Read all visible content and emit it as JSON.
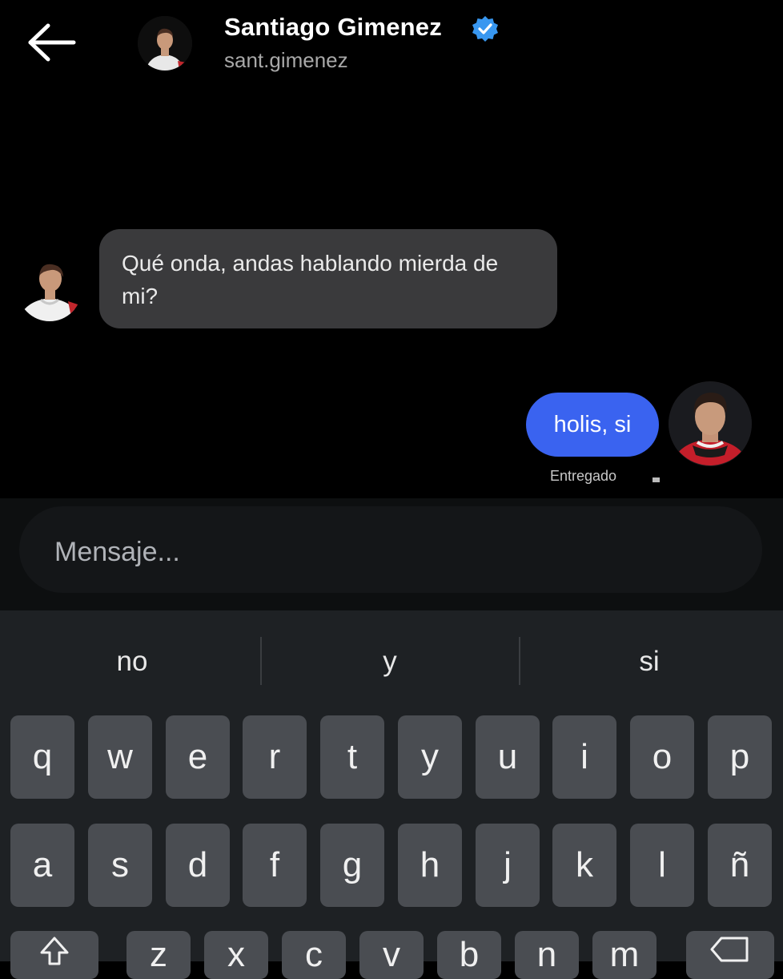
{
  "header": {
    "name": "Santiago Gimenez",
    "handle": "sant.gimenez",
    "verified": true,
    "back_icon": "arrow-left-icon",
    "verified_color": "#3897f0"
  },
  "messages": [
    {
      "direction": "incoming",
      "text": "Qué onda, andas hablando mierda de mi?"
    },
    {
      "direction": "outgoing",
      "text": "holis, si",
      "status": "Entregado"
    }
  ],
  "composer": {
    "placeholder": "Mensaje..."
  },
  "keyboard": {
    "suggestions": [
      "no",
      "y",
      "si"
    ],
    "row1": [
      "q",
      "w",
      "e",
      "r",
      "t",
      "y",
      "u",
      "i",
      "o",
      "p"
    ],
    "row2": [
      "a",
      "s",
      "d",
      "f",
      "g",
      "h",
      "j",
      "k",
      "l",
      "ñ"
    ],
    "row3": [
      "shift",
      "z",
      "x",
      "c",
      "v",
      "b",
      "n",
      "m",
      "backspace"
    ]
  },
  "colors": {
    "background": "#000000",
    "incoming_bubble": "#3a3a3c",
    "outgoing_bubble": "#3a63f0",
    "keyboard_bg": "#1e2124",
    "key_bg": "#4a4d52"
  }
}
